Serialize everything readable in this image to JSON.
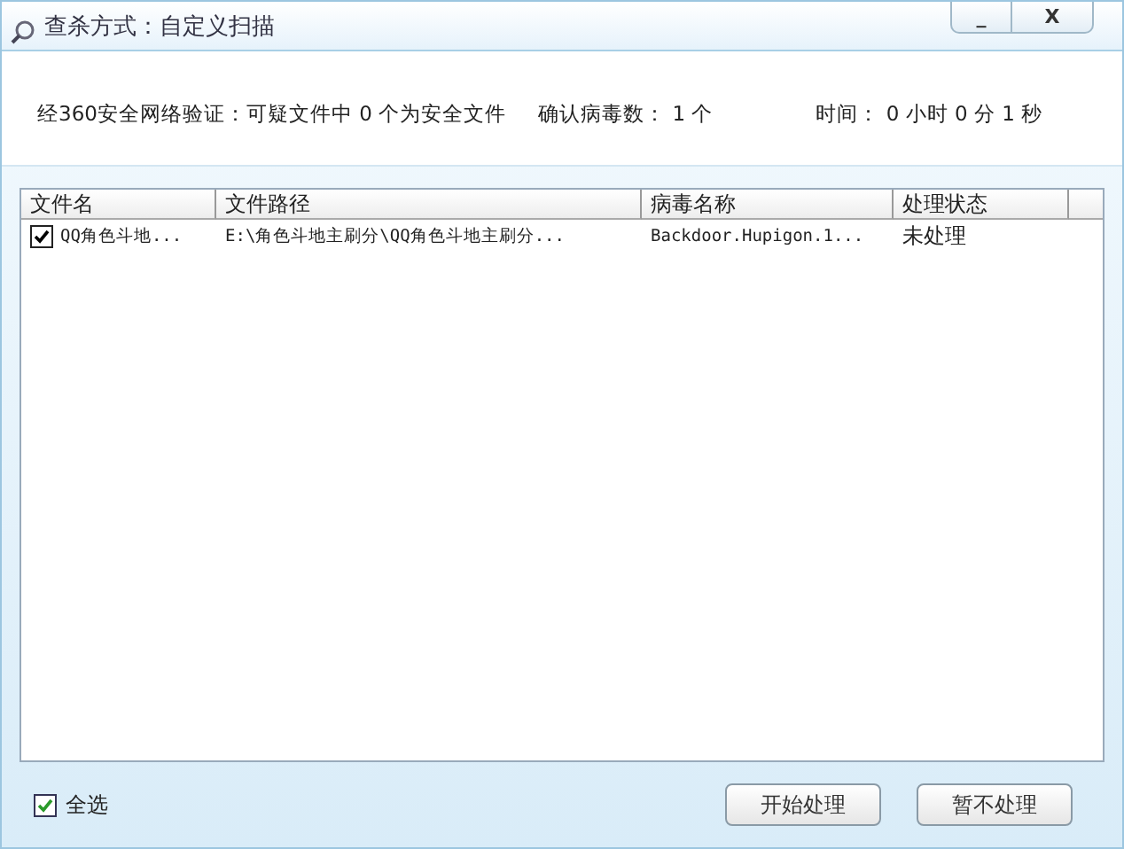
{
  "window": {
    "title": "查杀方式：自定义扫描",
    "buttons": [
      "_",
      "X"
    ]
  },
  "summary": {
    "verified": "经360安全网络验证：可疑文件中 0 个为安全文件",
    "confirmed": "确认病毒数： 1 个",
    "time": "时间： 0 小时  0 分  1 秒"
  },
  "table": {
    "columns": [
      "文件名",
      "文件路径",
      "病毒名称",
      "处理状态"
    ],
    "rows": [
      {
        "checked": true,
        "cells": [
          "QQ角色斗地...",
          "E:\\角色斗地主刷分\\QQ角色斗地主刷分...",
          "Backdoor.Hupigon.1...",
          "未处理"
        ]
      }
    ]
  },
  "select_all": {
    "label": "全选",
    "checked": true
  },
  "buttons": [
    "开始处理",
    "暂不处理"
  ]
}
